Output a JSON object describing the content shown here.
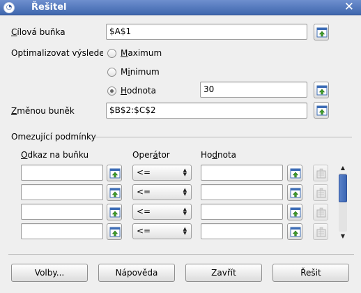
{
  "window": {
    "title": "Řešitel",
    "app_icon": "openoffice-icon",
    "close_glyph": "✕"
  },
  "target_cell": {
    "label": "Cílová buňka",
    "value": "$A$1"
  },
  "optimize": {
    "label": "Optimalizovat výsledek n",
    "options": [
      {
        "label": "Maximum",
        "checked": false
      },
      {
        "label": "Minimum",
        "checked": false
      },
      {
        "label": "Hodnota",
        "checked": true
      }
    ],
    "value_field": "30"
  },
  "changing_cells": {
    "label": "Změnou buněk",
    "value": "$B$2:$C$2"
  },
  "constraints": {
    "section_title": "Omezující podmínky",
    "columns": {
      "cell_ref": "Odkaz na buňku",
      "operator": "Operátor",
      "value": "Hodnota"
    },
    "rows": [
      {
        "cell_ref": "",
        "operator": "<=",
        "value": ""
      },
      {
        "cell_ref": "",
        "operator": "<=",
        "value": ""
      },
      {
        "cell_ref": "",
        "operator": "<=",
        "value": ""
      },
      {
        "cell_ref": "",
        "operator": "<=",
        "value": ""
      }
    ]
  },
  "buttons": {
    "options": "Volby...",
    "help": "Nápověda",
    "close": "Zavřít",
    "solve": "Řešit"
  }
}
